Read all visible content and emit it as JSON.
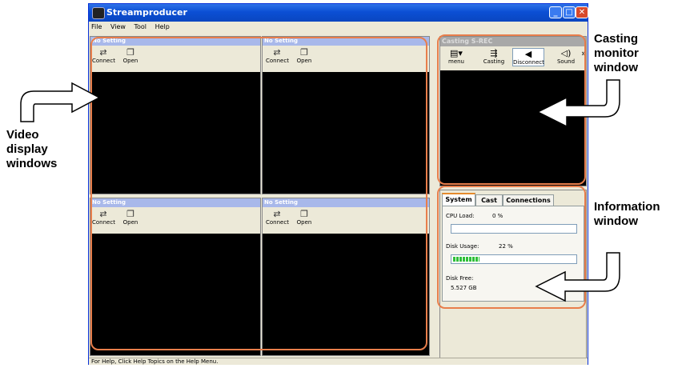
{
  "window": {
    "title": "Streamproducer"
  },
  "menu": [
    "File",
    "View",
    "Tool",
    "Help"
  ],
  "panes": [
    {
      "header": "No Setting",
      "connect": "Connect",
      "open": "Open"
    },
    {
      "header": "No Setting",
      "connect": "Connect",
      "open": "Open"
    },
    {
      "header": "No Setting",
      "connect": "Connect",
      "open": "Open"
    },
    {
      "header": "No Setting",
      "connect": "Connect",
      "open": "Open"
    }
  ],
  "casting": {
    "header": "Casting  S-REC",
    "buttons": [
      "menu",
      "Casting",
      "Disconnect",
      "Sound"
    ]
  },
  "info": {
    "tabs": [
      "System",
      "Cast",
      "Connections"
    ],
    "cpu_label": "CPU Load:",
    "cpu_value": "0 %",
    "cpu_fraction": 0,
    "disk_label": "Disk Usage:",
    "disk_value": "22 %",
    "disk_fraction": 0.22,
    "free_label": "Disk Free:",
    "free_value": "5.527 GB"
  },
  "status": "For Help, Click Help Topics on the Help Menu.",
  "annotations": {
    "video": [
      "Video",
      "display",
      "windows"
    ],
    "casting": [
      "Casting",
      "monitor",
      "window"
    ],
    "info": [
      "Information",
      "window"
    ]
  },
  "colors": {
    "highlight": "#e87e4b",
    "titlebar": "#0b4fd4"
  }
}
